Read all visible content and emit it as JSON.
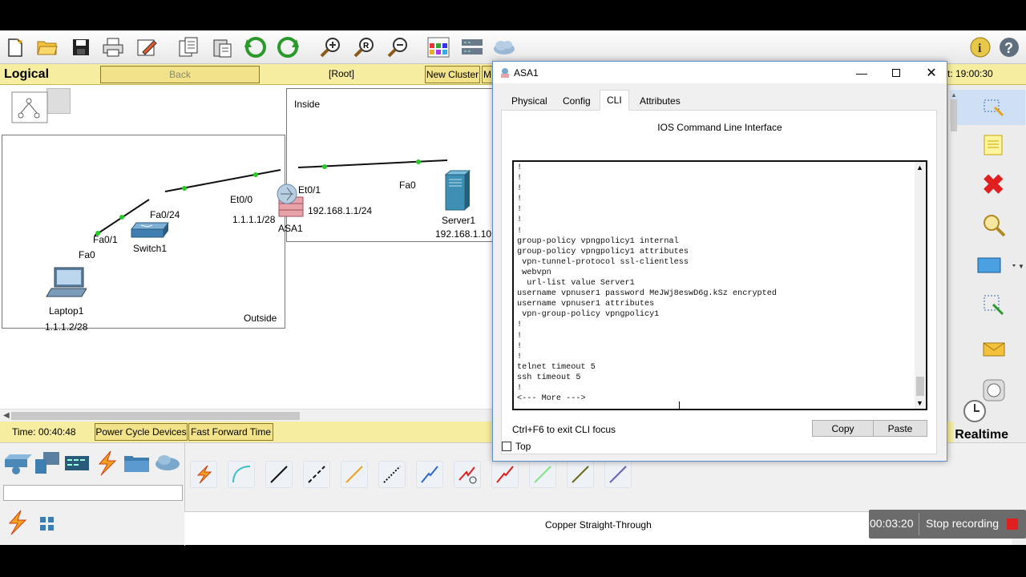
{
  "toolbar": {
    "icons": [
      "new-file-icon",
      "open-folder-icon",
      "save-icon",
      "print-icon",
      "activity-wizard-icon",
      "copy-icon",
      "paste-icon",
      "undo-icon",
      "redo-icon",
      "zoom-in-icon",
      "zoom-reset-icon",
      "zoom-out-icon",
      "palette-icon",
      "custom-device-icon",
      "cloud-icon",
      "info-icon",
      "help-icon"
    ]
  },
  "navbar": {
    "mode": "Logical",
    "back": "Back",
    "root": "[Root]",
    "new_cluster": "New Cluster",
    "move_partial": "M",
    "time_partial": "t: 19:00:30"
  },
  "topology": {
    "inside_label": "Inside",
    "outside_label": "Outside",
    "laptop": {
      "name": "Laptop1",
      "ip": "1.1.1.2/28",
      "port": "Fa0"
    },
    "switch": {
      "name": "Switch1",
      "port_a": "Fa0/1",
      "port_b": "Fa0/24"
    },
    "asa": {
      "name": "ASA1",
      "port_out": "Et0/0",
      "ip_out": "1.1.1.1/28",
      "port_in": "Et0/1",
      "ip_in": "192.168.1.1/24"
    },
    "server": {
      "name": "Server1",
      "ip": "192.168.1.10",
      "port": "Fa0"
    }
  },
  "status": {
    "time": "Time: 00:40:48",
    "power_cycle": "Power Cycle Devices",
    "fast_forward": "Fast Forward Time",
    "realtime": "Realtime"
  },
  "bottom": {
    "cable_name": "Copper Straight-Through",
    "recording_time": "00:03:20",
    "stop_recording": "Stop recording",
    "search_value": ""
  },
  "dialog": {
    "title": "ASA1",
    "tabs": [
      "Physical",
      "Config",
      "CLI",
      "Attributes"
    ],
    "active_tab": "CLI",
    "heading": "IOS Command Line Interface",
    "console_text": "!\n!\n!\n!\n!\n!\n!\ngroup-policy vpngpolicy1 internal\ngroup-policy vpngpolicy1 attributes\n vpn-tunnel-protocol ssl-clientless\n webvpn\n  url-list value Server1\nusername vpnuser1 password MeJWj8eswD6g.kSz encrypted\nusername vpnuser1 attributes\n vpn-group-policy vpngpolicy1\n!\n!\n!\n!\ntelnet timeout 5\nssh timeout 5\n!\n<--- More --->",
    "hint": "Ctrl+F6 to exit CLI focus",
    "copy": "Copy",
    "paste": "Paste",
    "top": "Top"
  },
  "colors": {
    "accent_yellow": "#f6eda0",
    "link_green": "#22cc22",
    "record_red": "#e02020",
    "title_blue": "#2a7bd3"
  }
}
